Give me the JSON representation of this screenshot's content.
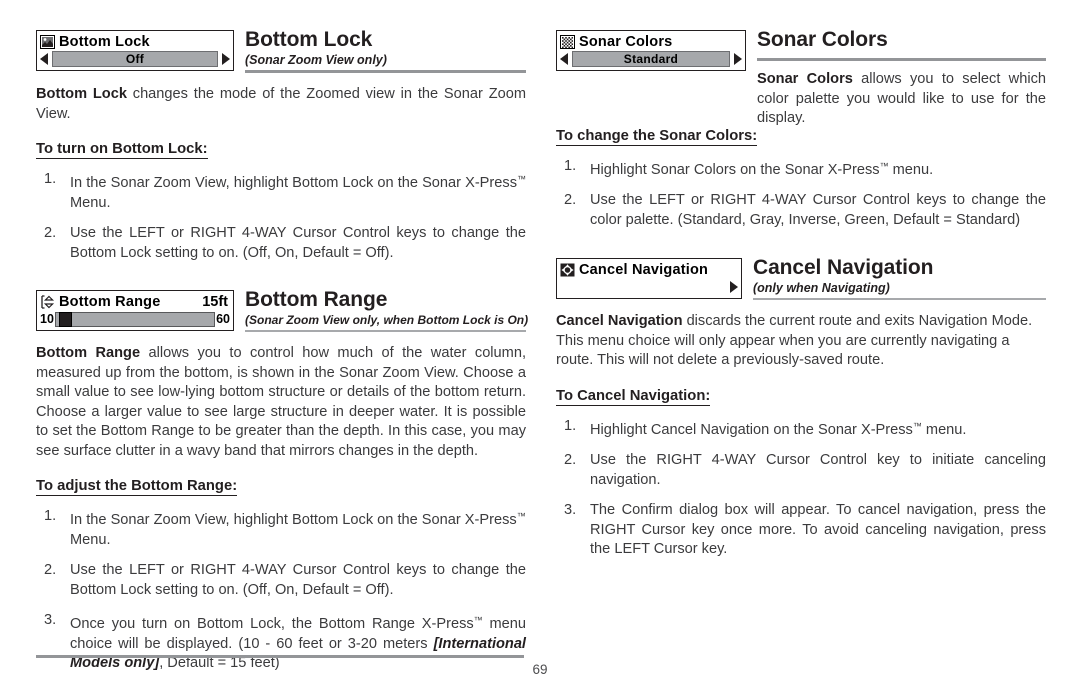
{
  "page": {
    "number": "69"
  },
  "left_column": {
    "sections": [
      {
        "widget": {
          "icon": "bottom-lock-sonar-icon",
          "title": "Bottom Lock",
          "control_type": "selector",
          "value": "Off",
          "left_arrow": "left-arrow-icon",
          "right_arrow": "right-arrow-icon"
        },
        "title": "Bottom Lock",
        "note": "(Sonar Zoom View only)",
        "intro": {
          "bold": "Bottom Lock",
          "rest": " changes the mode of the Zoomed view in the Sonar Zoom View."
        },
        "subheading": "To turn on Bottom Lock:",
        "steps": [
          "In the Sonar Zoom View, highlight Bottom Lock on the Sonar X-Press™ Menu.",
          "Use the LEFT or RIGHT 4-WAY Cursor Control keys to change the Bottom Lock setting to on. (Off, On, Default = Off)."
        ]
      },
      {
        "widget": {
          "icon": "bottom-range-icon",
          "title": "Bottom Range",
          "value_right": "15ft",
          "control_type": "slider",
          "slider_min": "10",
          "slider_max": "60",
          "slider_position_percent": 7
        },
        "title": "Bottom Range",
        "note": "(Sonar Zoom View only, when Bottom Lock is On)",
        "intro": {
          "bold": "Bottom Range",
          "rest": " allows you to control how much of the water column, measured up from the bottom, is shown in the Sonar Zoom View. Choose a small value to see low-lying bottom structure or details of the bottom return. Choose a larger value to see large structure in deeper water.  It is possible to set the Bottom Range to be greater than the depth.  In this case, you may see surface clutter in a wavy band that mirrors changes in the depth."
        },
        "subheading": "To adjust the Bottom Range:",
        "steps": [
          "In the Sonar Zoom View, highlight Bottom Lock on the Sonar X-Press™ Menu.",
          "Use the LEFT or RIGHT 4-WAY Cursor Control keys to change the Bottom Lock setting to on. (Off, On, Default = Off).",
          "Once you turn on Bottom Lock, the Bottom Range X-Press™  menu choice will be displayed. (10 - 60 feet or 3-20 meters [International Models only], Default = 15 feet)"
        ],
        "step3_parts": {
          "a": "Once you turn on Bottom Lock, the Bottom Range X-Press",
          "tm": "™",
          "b": "  menu choice will be displayed. (10 - 60 feet or 3-20 meters ",
          "italic": "[International Models only]",
          "c": ", Default = 15 feet)"
        }
      }
    ]
  },
  "right_column": {
    "sections": [
      {
        "widget": {
          "icon": "sonar-colors-checker-icon",
          "title": "Sonar Colors",
          "control_type": "selector",
          "value": "Standard",
          "left_arrow": "left-arrow-icon",
          "right_arrow": "right-arrow-icon"
        },
        "title": "Sonar Colors",
        "note": "",
        "intro": {
          "bold": "Sonar Colors",
          "rest": " allows you to select which color palette you would like to use for the display."
        },
        "subheading": "To change the Sonar Colors:",
        "steps": [
          "Highlight Sonar Colors on the Sonar X-Press™ menu.",
          "Use the LEFT or RIGHT 4-WAY Cursor Control keys to change the color palette. (Standard, Gray, Inverse, Green, Default = Standard)"
        ]
      },
      {
        "widget": {
          "icon": "cancel-navigation-icon",
          "title": "Cancel Navigation",
          "control_type": "arrow-only",
          "right_arrow": "right-arrow-icon"
        },
        "title": "Cancel Navigation",
        "note": "(only when Navigating)",
        "intro": {
          "bold": "Cancel Navigation",
          "rest": " discards the current route and exits Navigation Mode. This menu choice will only appear when you are currently navigating a route. This will not delete a previously-saved route."
        },
        "subheading": "To Cancel Navigation:",
        "steps": [
          "Highlight Cancel Navigation on the Sonar X-Press™ menu.",
          "Use the RIGHT 4-WAY Cursor Control key to initiate canceling navigation.",
          "The Confirm dialog box will appear. To cancel navigation, press the RIGHT Cursor key once more. To avoid canceling navigation, press the LEFT Cursor key."
        ]
      }
    ]
  },
  "colors": {
    "text": "#3b3b3d",
    "heading": "#231f20",
    "rule": "#939598",
    "pill_fill": "#a6a8ab"
  }
}
